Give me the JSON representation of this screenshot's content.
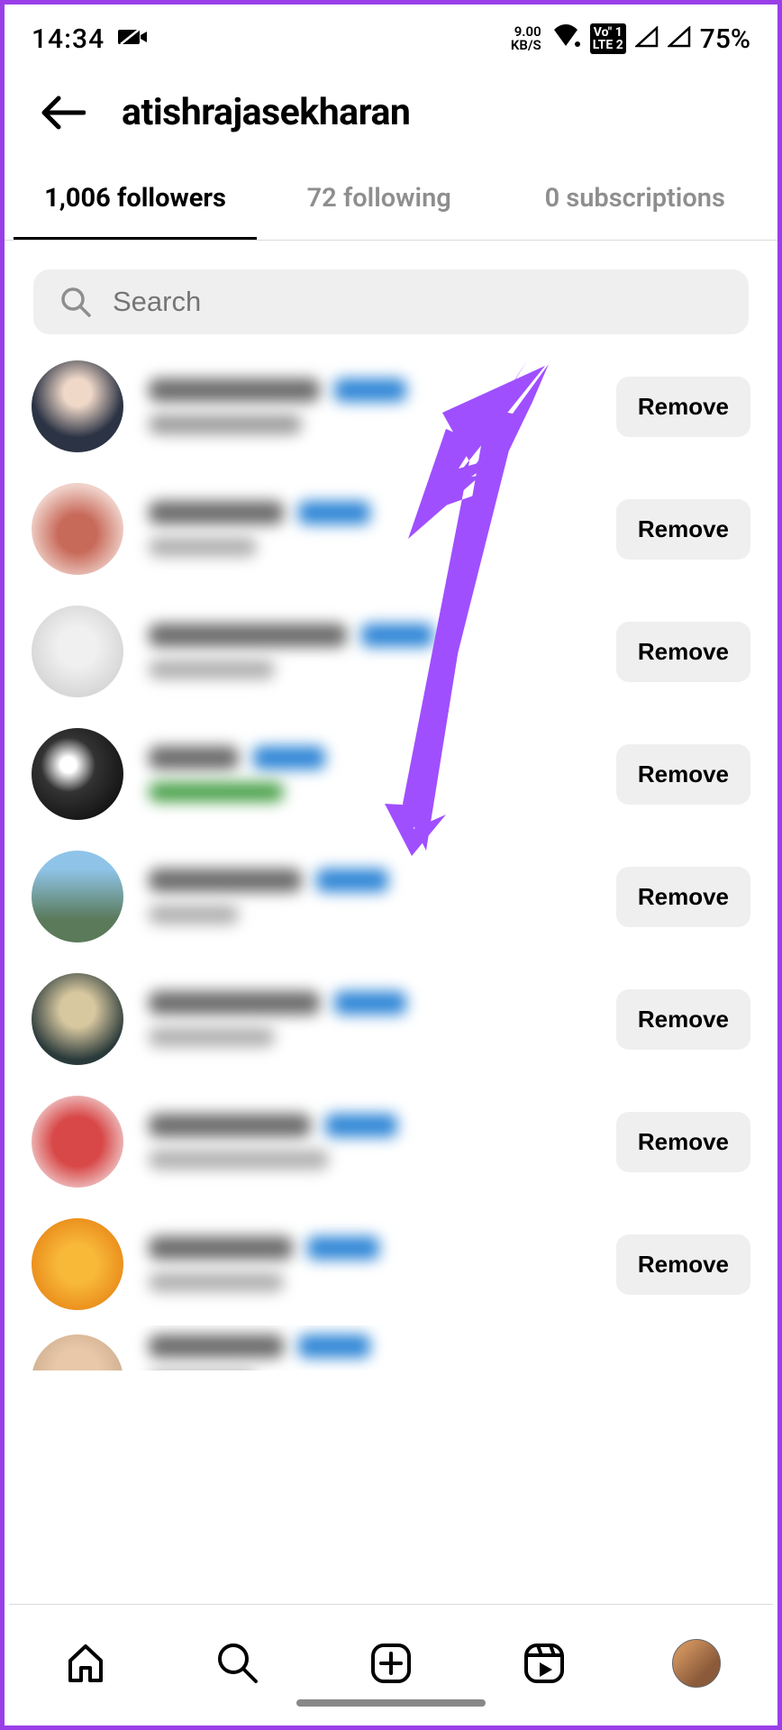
{
  "status": {
    "time": "14:34",
    "kbps_top": "9.00",
    "kbps_bottom": "KB/S",
    "lte_top": "Vo\" 1",
    "lte_bottom": "LTE 2",
    "battery": "75%"
  },
  "header": {
    "title": "atishrajasekharan"
  },
  "tabs": {
    "followers": "1,006 followers",
    "following": "72 following",
    "subscriptions": "0 subscriptions"
  },
  "search": {
    "placeholder": "Search"
  },
  "remove_label": "Remove",
  "followers": [
    {
      "avatar_bg": "radial-gradient(circle at 50% 35%, #f0d8c8 18%, #2b3344 60%)",
      "u_w": 190,
      "u_bg": "#6b6b6b",
      "f_w": 80,
      "f_bg": "#2f86d6",
      "s_w": 170,
      "s_bg": "#9c9c9c"
    },
    {
      "avatar_bg": "radial-gradient(circle at 50% 55%, #c86a5a 28%, #efd0c8 70%)",
      "u_w": 150,
      "u_bg": "#6b6b6b",
      "f_w": 80,
      "f_bg": "#2f86d6",
      "s_w": 120,
      "s_bg": "#b0b0b0"
    },
    {
      "avatar_bg": "radial-gradient(circle at 50% 45%, #f0f0f0 28%, #d8d8d8 70%)",
      "u_w": 220,
      "u_bg": "#6b6b6b",
      "f_w": 80,
      "f_bg": "#2f86d6",
      "s_w": 140,
      "s_bg": "#b0b0b0"
    },
    {
      "avatar_bg": "radial-gradient(circle at 40% 40%, #ffffff 10%, #333 35%, #111 80%)",
      "u_w": 100,
      "u_bg": "#6b6b6b",
      "f_w": 80,
      "f_bg": "#2f86d6",
      "s_w": 150,
      "s_bg": "#4aa04a",
      "emoji": true
    },
    {
      "avatar_bg": "linear-gradient(180deg,#8fc4e8 20%,#5a7a5a 75%)",
      "u_w": 170,
      "u_bg": "#6b6b6b",
      "f_w": 80,
      "f_bg": "#2f86d6",
      "s_w": 100,
      "s_bg": "#b0b0b0"
    },
    {
      "avatar_bg": "radial-gradient(circle at 50% 40%, #d8c8a0 24%, #2a3a3a 70%)",
      "u_w": 190,
      "u_bg": "#6b6b6b",
      "f_w": 80,
      "f_bg": "#2f86d6",
      "s_w": 140,
      "s_bg": "#b0b0b0"
    },
    {
      "avatar_bg": "radial-gradient(circle at 50% 50%, #d84848 38%, #f0c8c8 78%)",
      "u_w": 180,
      "u_bg": "#6b6b6b",
      "f_w": 80,
      "f_bg": "#2f86d6",
      "s_w": 200,
      "s_bg": "#b0b0b0"
    },
    {
      "avatar_bg": "radial-gradient(circle at 50% 50%, #f8b838 30%, #e88818 80%)",
      "u_w": 160,
      "u_bg": "#6b6b6b",
      "f_w": 80,
      "f_bg": "#2f86d6",
      "s_w": 150,
      "s_bg": "#b0b0b0"
    },
    {
      "avatar_bg": "radial-gradient(circle at 50% 40%, #e8c8a8 30%, #c8a888 80%)",
      "u_w": 150,
      "u_bg": "#6b6b6b",
      "f_w": 80,
      "f_bg": "#2f86d6",
      "s_w": 120,
      "s_bg": "#b0b0b0",
      "cut": true
    }
  ]
}
